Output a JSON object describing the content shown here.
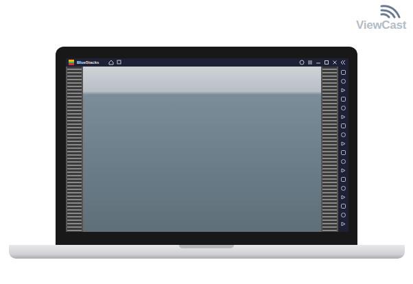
{
  "logo": {
    "text": "ViewCast"
  },
  "window": {
    "title": "BlueStacks"
  }
}
